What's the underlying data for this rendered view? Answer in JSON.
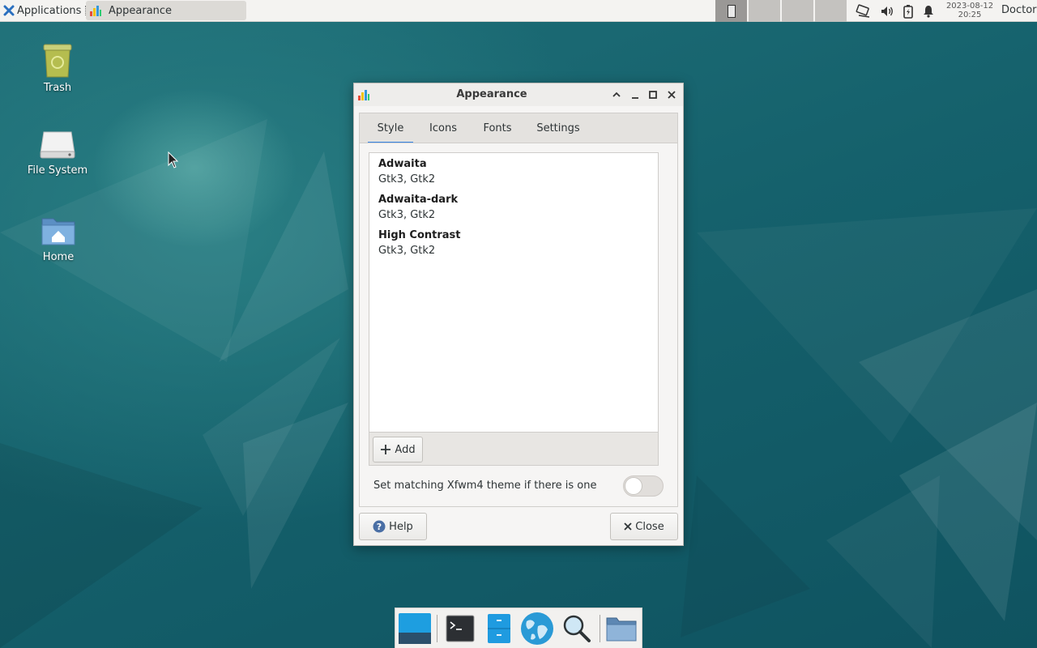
{
  "top_panel": {
    "applications_label": "Applications",
    "task_label": "Appearance",
    "clock_date": "2023-08-12",
    "clock_time": "20:25",
    "user_label": "Doctor",
    "workspaces": 4
  },
  "desktop_icons": [
    {
      "label": "Trash",
      "icon": "trash-icon"
    },
    {
      "label": "File System",
      "icon": "drive-icon"
    },
    {
      "label": "Home",
      "icon": "home-folder-icon"
    }
  ],
  "window": {
    "title": "Appearance",
    "tabs": [
      {
        "label": "Style",
        "active": true
      },
      {
        "label": "Icons",
        "active": false
      },
      {
        "label": "Fonts",
        "active": false
      },
      {
        "label": "Settings",
        "active": false
      }
    ],
    "themes": [
      {
        "name": "Adwaita",
        "sub": "Gtk3, Gtk2"
      },
      {
        "name": "Adwaita-dark",
        "sub": "Gtk3, Gtk2"
      },
      {
        "name": "High Contrast",
        "sub": "Gtk3, Gtk2"
      }
    ],
    "add_label": "Add",
    "switch_label": "Set matching Xfwm4 theme if there is one",
    "switch_on": false,
    "help_label": "Help",
    "close_label": "Close"
  },
  "dock": [
    "show-desktop-icon",
    "terminal-icon",
    "file-manager-icon",
    "web-browser-icon",
    "app-finder-icon",
    "folder-icon"
  ],
  "colors": {
    "accent": "#3584e4",
    "desktop": "#135f6b"
  }
}
